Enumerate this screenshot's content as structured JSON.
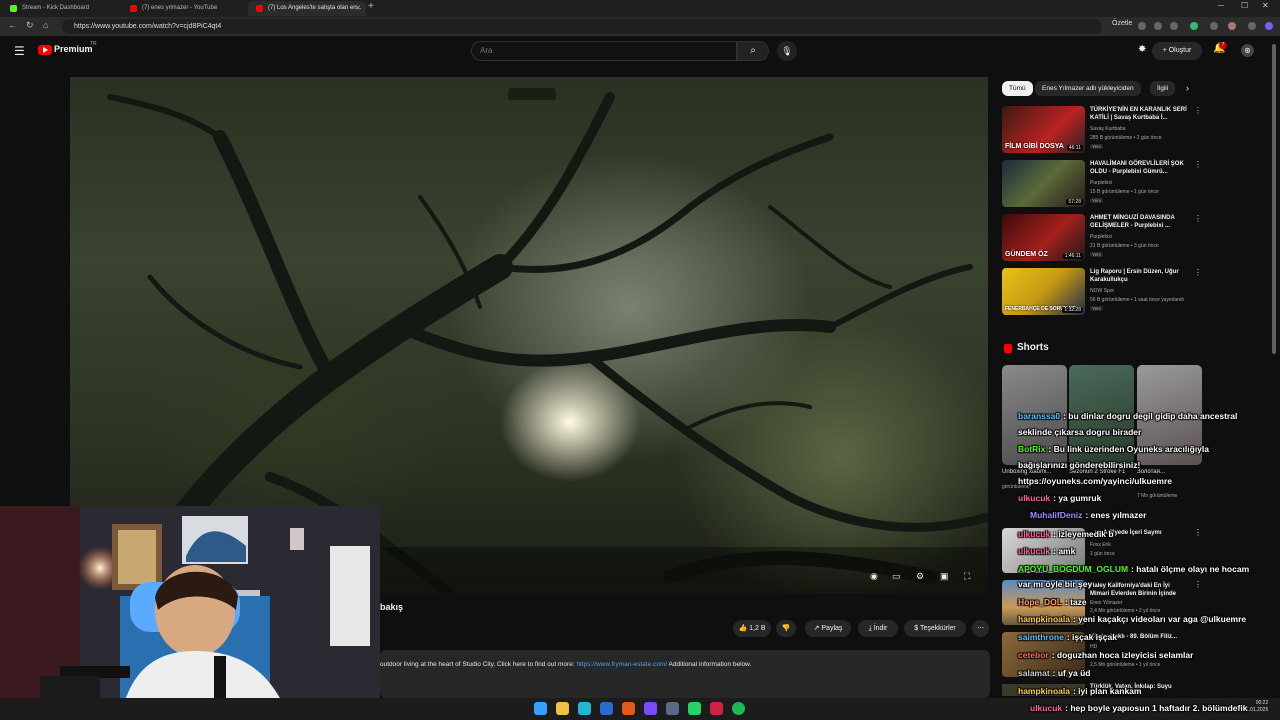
{
  "browser": {
    "tabs": [
      {
        "label": "Stream - Kick Dashboard",
        "color": "#53fc18"
      },
      {
        "label": "(7) enes yılmazer - YouTube",
        "color": "#ff0000"
      },
      {
        "label": "(7) Los Angeles'te satışta olan en...",
        "color": "#ff0000"
      }
    ],
    "new_tab": "+",
    "url": "https://www.youtube.com/watch?v=cjd8PiC4qt4",
    "summarize": "Özetle",
    "win_min": "─",
    "win_max": "☐",
    "win_close": "✕"
  },
  "yt": {
    "logo_text": "Premium",
    "logo_tm": "TR",
    "search_placeholder": "Ara",
    "create_label": "Oluştur",
    "notif_count": "7"
  },
  "video": {
    "title_fragment": "bakış",
    "likes": "1,2 B",
    "share": "Paylaş",
    "download": "İndir",
    "thanks": "Teşekkürler",
    "desc_before": "outdoor living at the heart of Studio City.  Click here to find out more: ",
    "desc_link": "https://www.fryman-estate.com/",
    "desc_after": " Additional information below."
  },
  "chips": [
    "Tümü",
    "Enes Yılmazer adlı yükleyiciden",
    "İlgili"
  ],
  "recs": [
    {
      "title": "TÜRKİYE'NİN EN KARANLIK SERİ KATİLİ | Savaş Kurtbaba İ...",
      "channel": "Savaş Kurtbaba",
      "meta": "285 B görüntüleme • 2 gün önce",
      "duration": "46:11",
      "thumb_text": "FİLM GİBİ DOSYA",
      "new": "Yeni"
    },
    {
      "title": "HAVALİMANI GÖREVLİLERİ ŞOK OLDU - Purplebixi Gümrü...",
      "channel": "Purplebixi",
      "meta": "15 B görüntüleme • 1 gün önce",
      "duration": "57:28",
      "thumb_text": "",
      "new": "Yeni"
    },
    {
      "title": "AHMET MİNGUZİ DAVASINDA GELİŞMELER - Purplebixi ...",
      "channel": "Purplebixi",
      "meta": "21 B görüntüleme • 3 gün önce",
      "duration": "1:46:11",
      "thumb_text": "GÜNDEM ÖZ",
      "new": "Yeni"
    },
    {
      "title": "Lig Raporu | Ersin Düzen, Uğur Karakullukçu",
      "channel": "NOW Spor",
      "meta": "56 B görüntüleme • 1 saat önce yayınlandı",
      "duration": "1:32:28",
      "thumb_text": "FENERBAHÇE DE SORUN NE",
      "new": "Yeni"
    }
  ],
  "shorts": {
    "title": "Shorts",
    "items": [
      {
        "label": "Unboxing xiaomi..."
      },
      {
        "label": "Sezonun 2 Stroke F1"
      },
      {
        "label": "Золотая..."
      }
    ],
    "meta": [
      "görüntüleme",
      "7 Mn görüntüleme"
    ]
  },
  "recs2": [
    {
      "title": "...ve Adliyede İçeri Saymı",
      "channel": "Foxx Erik",
      "meta": "1 gün önce"
    },
    {
      "title": "Haley Kaliforniya'daki En İyi Mimari Evlerden Birinin İçinde",
      "channel": "Enes Yılmazer",
      "meta": "2,4 Mn görüntüleme • 2 yıl önce"
    },
    {
      "title": "Kimler Haklı - 89. Bölüm Filiz...",
      "channel": "HD",
      "meta": "2,5 Mn görüntüleme • 1 yıl önce"
    },
    {
      "title": "Türklük, Vatan, İnkılap: Suyu",
      "channel": "",
      "meta": ""
    }
  ],
  "chat": [
    {
      "user": "baranssa0",
      "ucolor": "#58c7ff",
      "msg": ": bu dinlar dogru degil gidip daha ancestral"
    },
    {
      "user": "",
      "ucolor": "#ffffff",
      "msg": "seklinde çıkarsa dogru birader"
    },
    {
      "user": "BotRix",
      "ucolor": "#53fc18",
      "msg": ": Bu link üzerinden Oyuneks aracılığıyla"
    },
    {
      "user": "",
      "ucolor": "#ffffff",
      "msg": "bağışlarınızı gönderebilirsiniz!"
    },
    {
      "user": "",
      "ucolor": "#ffffff",
      "msg": "https://oyuneks.com/yayinci/ulkuemre"
    },
    {
      "user": "ulkucuk",
      "ucolor": "#ff5fa2",
      "msg": ": ya gumruk"
    },
    {
      "user": "MuhalifDeniz",
      "ucolor": "#9b8cff",
      "msg": ": enes yılmazer"
    },
    {
      "user": "ulkucuk",
      "ucolor": "#ff5fa2",
      "msg": ": izleyemedik b"
    },
    {
      "user": "ulkucuk",
      "ucolor": "#ff5fa2",
      "msg": ": amk"
    },
    {
      "user": "APOYU_BOGDUM_OGLUM",
      "ucolor": "#53fc18",
      "msg": ": hatalı ölçme olayı ne hocam"
    },
    {
      "user": "",
      "ucolor": "#ffffff",
      "msg": "var mı öyle bir şey"
    },
    {
      "user": "Hope_DOL",
      "ucolor": "#ff9966",
      "msg": ": taze"
    },
    {
      "user": "hampkinoala",
      "ucolor": "#ffd54f",
      "msg": ": yeni kaçakçı videoları var aga @ulkuemre"
    },
    {
      "user": "saimthrone",
      "ucolor": "#58c7ff",
      "msg": ": işçak işçak"
    },
    {
      "user": "cetebor",
      "ucolor": "#ff7043",
      "msg": ": doguzhan hoca izleyicisi selamlar"
    },
    {
      "user": "salamat",
      "ucolor": "#cccccc",
      "msg": ": uf ya üd"
    },
    {
      "user": "hampkinoala",
      "ucolor": "#ffd54f",
      "msg": ": iyi plan kankam"
    },
    {
      "user": "ulkucuk",
      "ucolor": "#ff5fa2",
      "msg": ": hep boyle yapıosun 1 haftadır 2. bölümdefik"
    }
  ],
  "clock": {
    "time": "00:22",
    "date": "1.01.2025"
  }
}
